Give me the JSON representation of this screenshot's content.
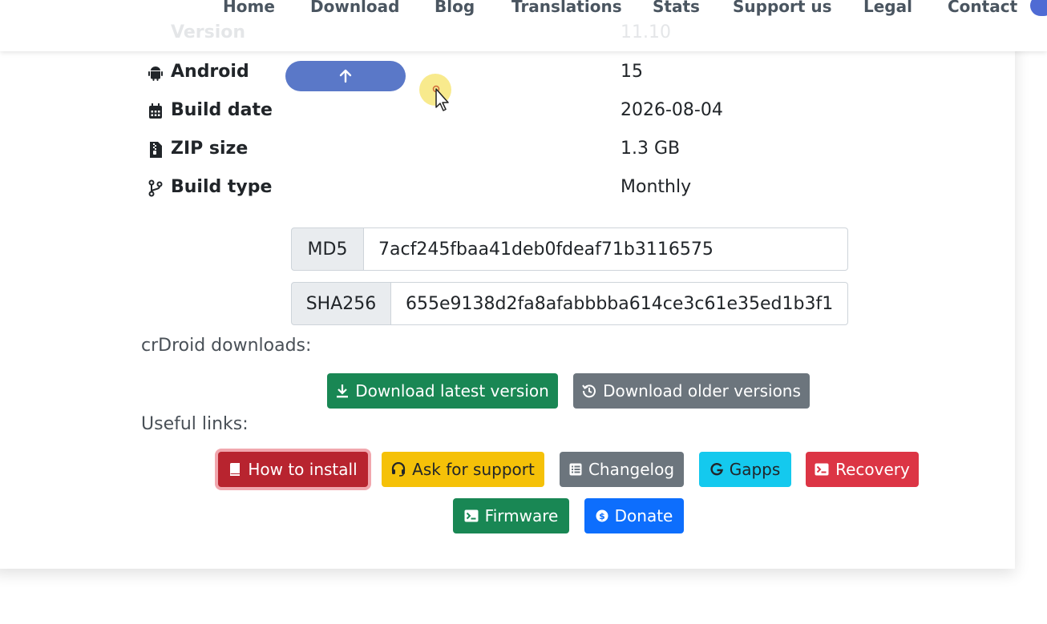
{
  "nav": {
    "items": [
      "Home",
      "Download",
      "Blog",
      "Translations",
      "Stats",
      "Support us",
      "Legal",
      "Contact"
    ]
  },
  "info": {
    "rows": [
      {
        "label": "Android",
        "value": "15",
        "icon": "android-icon"
      },
      {
        "label": "Build date",
        "value": "2026-08-04",
        "icon": "calendar-icon"
      },
      {
        "label": "ZIP size",
        "value": "1.3 GB",
        "icon": "zip-file-icon"
      },
      {
        "label": "Build type",
        "value": "Monthly",
        "icon": "branch-icon"
      }
    ],
    "ghost_label": "Version",
    "ghost_value": "11.10"
  },
  "hashes": {
    "md5": {
      "label": "MD5",
      "value": "7acf245fbaa41deb0fdeaf71b3116575"
    },
    "sha256": {
      "label": "SHA256",
      "value": "655e9138d2fa8afabbbba614ce3c61e35ed1b3f1"
    }
  },
  "downloads": {
    "title": "crDroid downloads:",
    "latest": "Download latest version",
    "older": "Download older versions"
  },
  "links": {
    "title": "Useful links:",
    "how_to_install": "How to install",
    "support": "Ask for support",
    "changelog": "Changelog",
    "gapps": "Gapps",
    "recovery": "Recovery",
    "firmware": "Firmware",
    "donate": "Donate"
  },
  "colors": {
    "danger": "#c0232f",
    "warning": "#f5c108",
    "secondary": "#6c757d",
    "info": "#14c9ee",
    "recovery": "#dc3545",
    "success": "#198754",
    "primary": "#0d6efd"
  }
}
